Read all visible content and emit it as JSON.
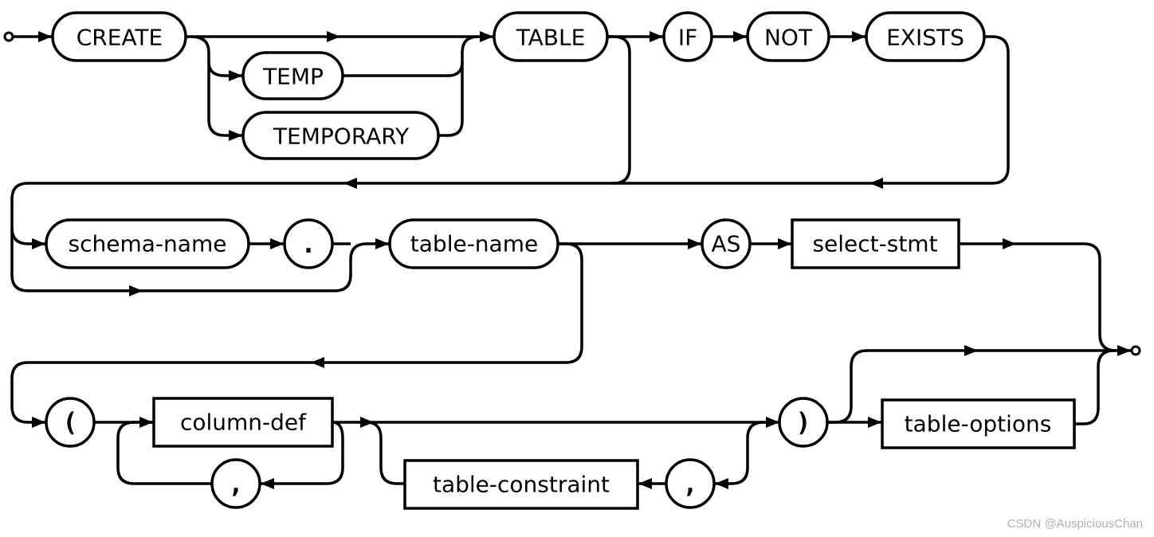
{
  "diagram": {
    "keywords": {
      "create": "CREATE",
      "temp": "TEMP",
      "temporary": "TEMPORARY",
      "table": "TABLE",
      "if": "IF",
      "not": "NOT",
      "exists": "EXISTS",
      "dot": ".",
      "as": "AS",
      "open_paren": "(",
      "close_paren": ")",
      "comma1": ",",
      "comma2": ","
    },
    "nonterminals": {
      "schema_name": "schema-name",
      "table_name": "table-name",
      "select_stmt": "select-stmt",
      "column_def": "column-def",
      "table_constraint": "table-constraint",
      "table_options": "table-options"
    }
  },
  "watermark": "CSDN @AuspiciousChan"
}
